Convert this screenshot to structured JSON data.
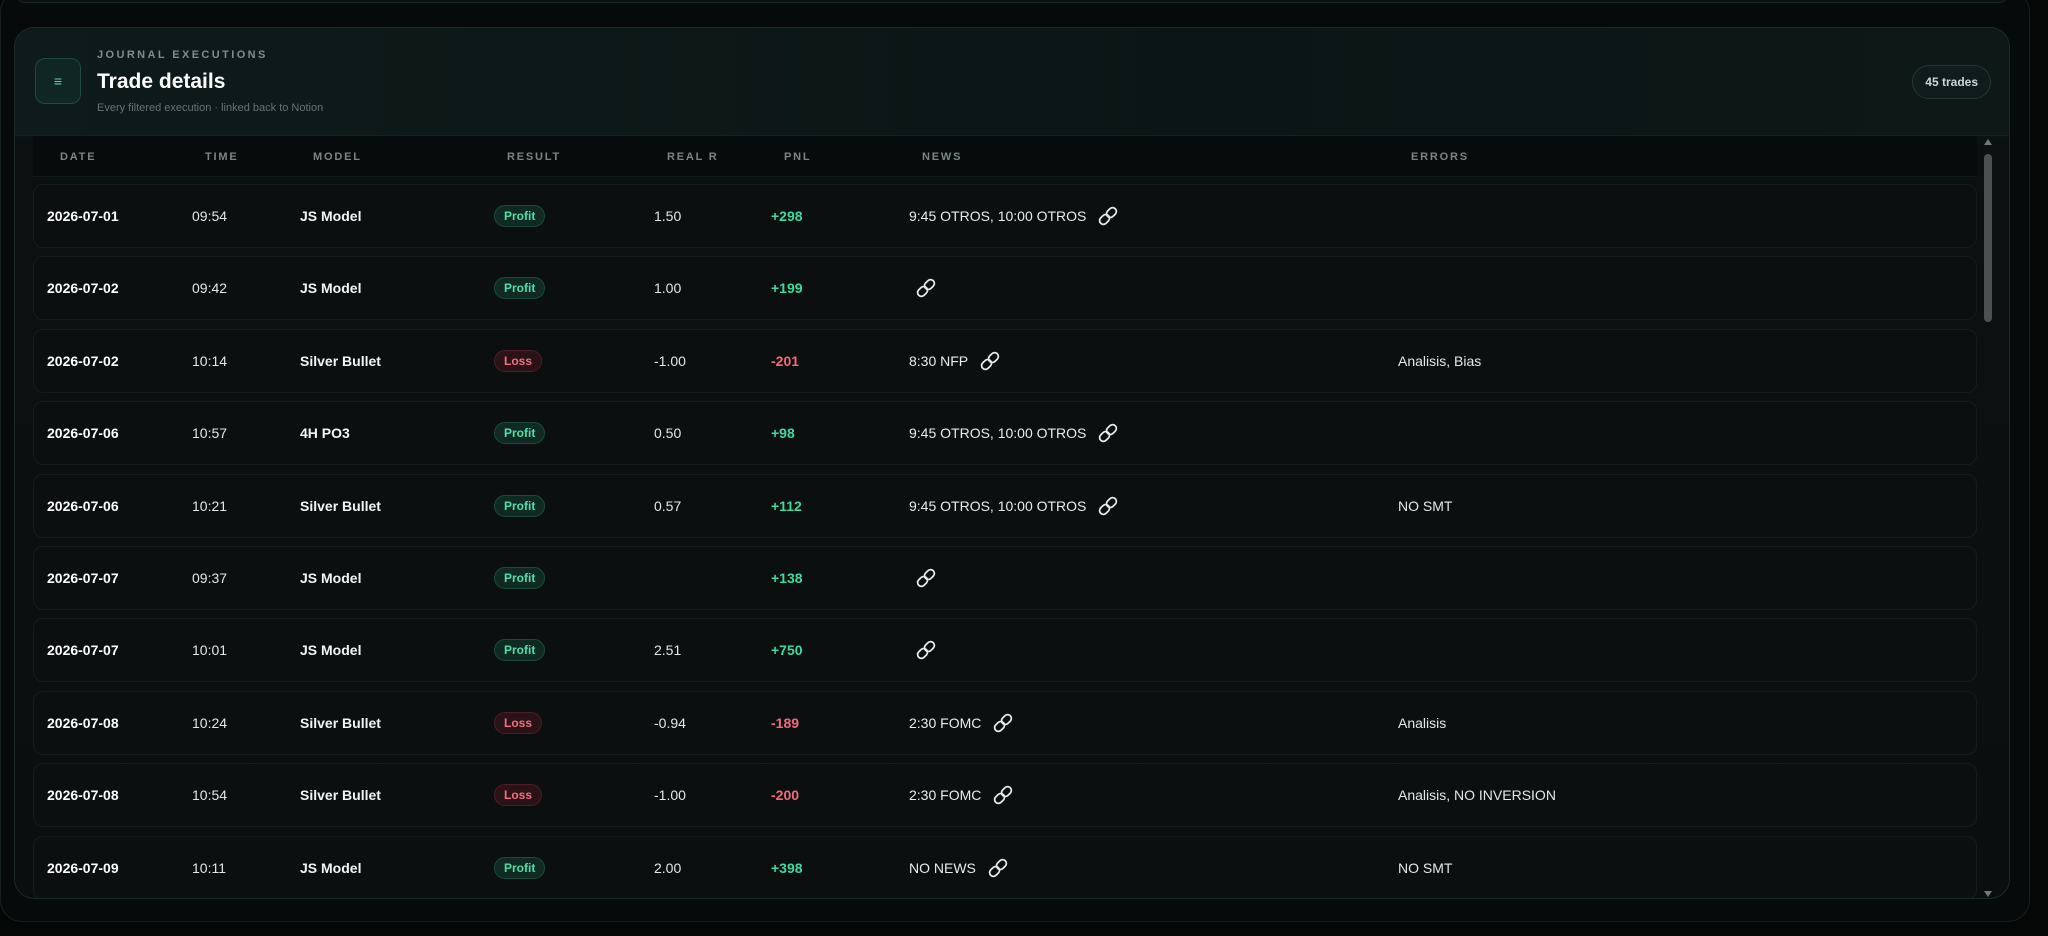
{
  "header": {
    "eyebrow": "JOURNAL EXECUTIONS",
    "title": "Trade details",
    "subtitle": "Every filtered execution · linked back to Notion",
    "count_badge": "45 trades",
    "icon": "menu-icon"
  },
  "columns": [
    "DATE",
    "TIME",
    "MODEL",
    "RESULT",
    "REAL R",
    "PNL",
    "NEWS",
    "ERRORS"
  ],
  "rows": [
    {
      "date": "2026-07-01",
      "time": "09:54",
      "model": "JS Model",
      "result": "Profit",
      "real_r": "1.50",
      "pnl": "+298",
      "news": "9:45 OTROS, 10:00 OTROS",
      "errors": ""
    },
    {
      "date": "2026-07-02",
      "time": "09:42",
      "model": "JS Model",
      "result": "Profit",
      "real_r": "1.00",
      "pnl": "+199",
      "news": "",
      "errors": ""
    },
    {
      "date": "2026-07-02",
      "time": "10:14",
      "model": "Silver Bullet",
      "result": "Loss",
      "real_r": "-1.00",
      "pnl": "-201",
      "news": "8:30 NFP",
      "errors": "Analisis, Bias"
    },
    {
      "date": "2026-07-06",
      "time": "10:57",
      "model": "4H PO3",
      "result": "Profit",
      "real_r": "0.50",
      "pnl": "+98",
      "news": "9:45 OTROS, 10:00 OTROS",
      "errors": ""
    },
    {
      "date": "2026-07-06",
      "time": "10:21",
      "model": "Silver Bullet",
      "result": "Profit",
      "real_r": "0.57",
      "pnl": "+112",
      "news": "9:45 OTROS, 10:00 OTROS",
      "errors": "NO SMT"
    },
    {
      "date": "2026-07-07",
      "time": "09:37",
      "model": "JS Model",
      "result": "Profit",
      "real_r": "",
      "pnl": "+138",
      "news": "",
      "errors": ""
    },
    {
      "date": "2026-07-07",
      "time": "10:01",
      "model": "JS Model",
      "result": "Profit",
      "real_r": "2.51",
      "pnl": "+750",
      "news": "",
      "errors": ""
    },
    {
      "date": "2026-07-08",
      "time": "10:24",
      "model": "Silver Bullet",
      "result": "Loss",
      "real_r": "-0.94",
      "pnl": "-189",
      "news": "2:30 FOMC",
      "errors": "Analisis"
    },
    {
      "date": "2026-07-08",
      "time": "10:54",
      "model": "Silver Bullet",
      "result": "Loss",
      "real_r": "-1.00",
      "pnl": "-200",
      "news": "2:30 FOMC",
      "errors": "Analisis, NO INVERSION"
    },
    {
      "date": "2026-07-09",
      "time": "10:11",
      "model": "JS Model",
      "result": "Profit",
      "real_r": "2.00",
      "pnl": "+398",
      "news": "NO NEWS",
      "errors": "NO SMT"
    }
  ],
  "icons": {
    "news_link": "link-icon"
  },
  "colors": {
    "profit": "#4fe0a6",
    "loss": "#f27083",
    "accent": "#5fd3b3",
    "background": "#0a0e0e"
  }
}
